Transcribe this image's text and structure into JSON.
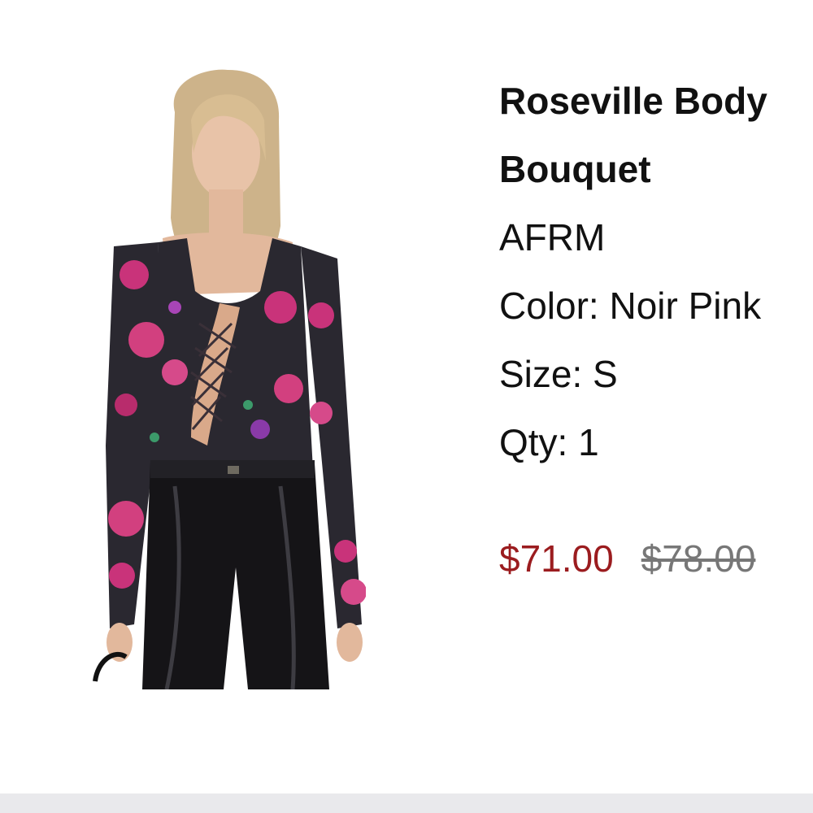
{
  "product": {
    "title_line1": "Roseville Body",
    "title_line2": "Bouquet",
    "brand": "AFRM",
    "color_line": "Color: Noir Pink",
    "size_line": "Size: S",
    "qty_line": "Qty: 1",
    "sale_price": "$71.00",
    "original_price": "$78.00",
    "image_icon": "product-photo",
    "colors": {
      "sale_price": "#9b1c1f",
      "original_price": "#777777",
      "text": "#111111"
    }
  }
}
